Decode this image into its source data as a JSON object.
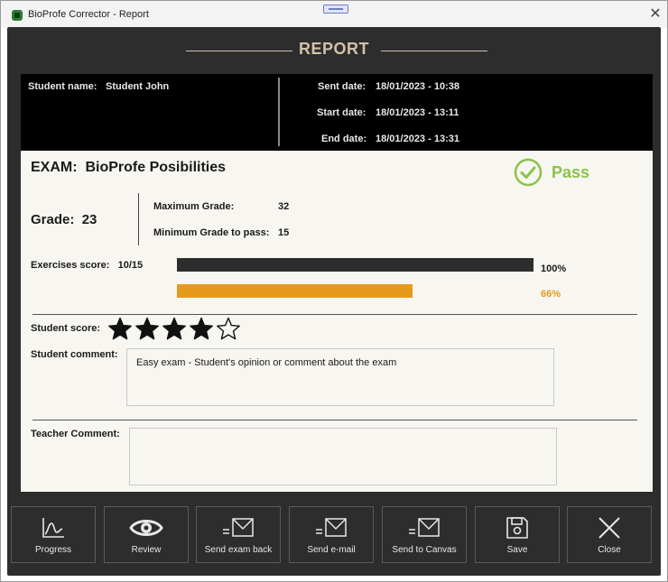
{
  "window": {
    "title": "BioProfe Corrector - Report",
    "close_glyph": "✕"
  },
  "report": {
    "heading": "REPORT"
  },
  "header": {
    "student_name_label": "Student name:",
    "student_name": "Student John",
    "sent_label": "Sent date:",
    "sent_value": "18/01/2023 - 10:38",
    "start_label": "Start date:",
    "start_value": "18/01/2023 - 13:11",
    "end_label": "End date:",
    "end_value": "18/01/2023 - 13:31"
  },
  "exam": {
    "label": "EXAM:",
    "name": "BioProfe Posibilities",
    "status": "Pass"
  },
  "grade": {
    "label": "Grade:",
    "value": "23",
    "max_label": "Maximum Grade:",
    "max_value": "32",
    "min_label": "Minimum Grade to pass:",
    "min_value": "15"
  },
  "exercises": {
    "label": "Exercises score:",
    "value": "10/15",
    "total_pct": "100%",
    "score_pct": "66%",
    "score_fraction": 0.66
  },
  "student_score": {
    "label": "Student score:",
    "stars_filled": 4,
    "stars_total": 5
  },
  "student_comment": {
    "label": "Student comment:",
    "text": "Easy exam - Student's opinion or comment about the exam"
  },
  "teacher_comment": {
    "label": "Teacher Comment:",
    "text": ""
  },
  "toolbar": {
    "progress": "Progress",
    "review": "Review",
    "send_exam_back": "Send exam back",
    "send_email": "Send e-mail",
    "send_canvas": "Send to Canvas",
    "save": "Save",
    "close": "Close"
  },
  "colors": {
    "accent": "#e59a1e",
    "pass": "#8bc34a",
    "title": "#d2c2aa",
    "panel": "#2d2d2d"
  },
  "icons": {
    "app": "app-icon",
    "progress": "chart-icon",
    "review": "eye-icon",
    "send_exam_back": "envelope-icon",
    "send_email": "envelope-icon",
    "send_canvas": "envelope-icon",
    "save": "floppy-icon",
    "close": "close-icon"
  }
}
